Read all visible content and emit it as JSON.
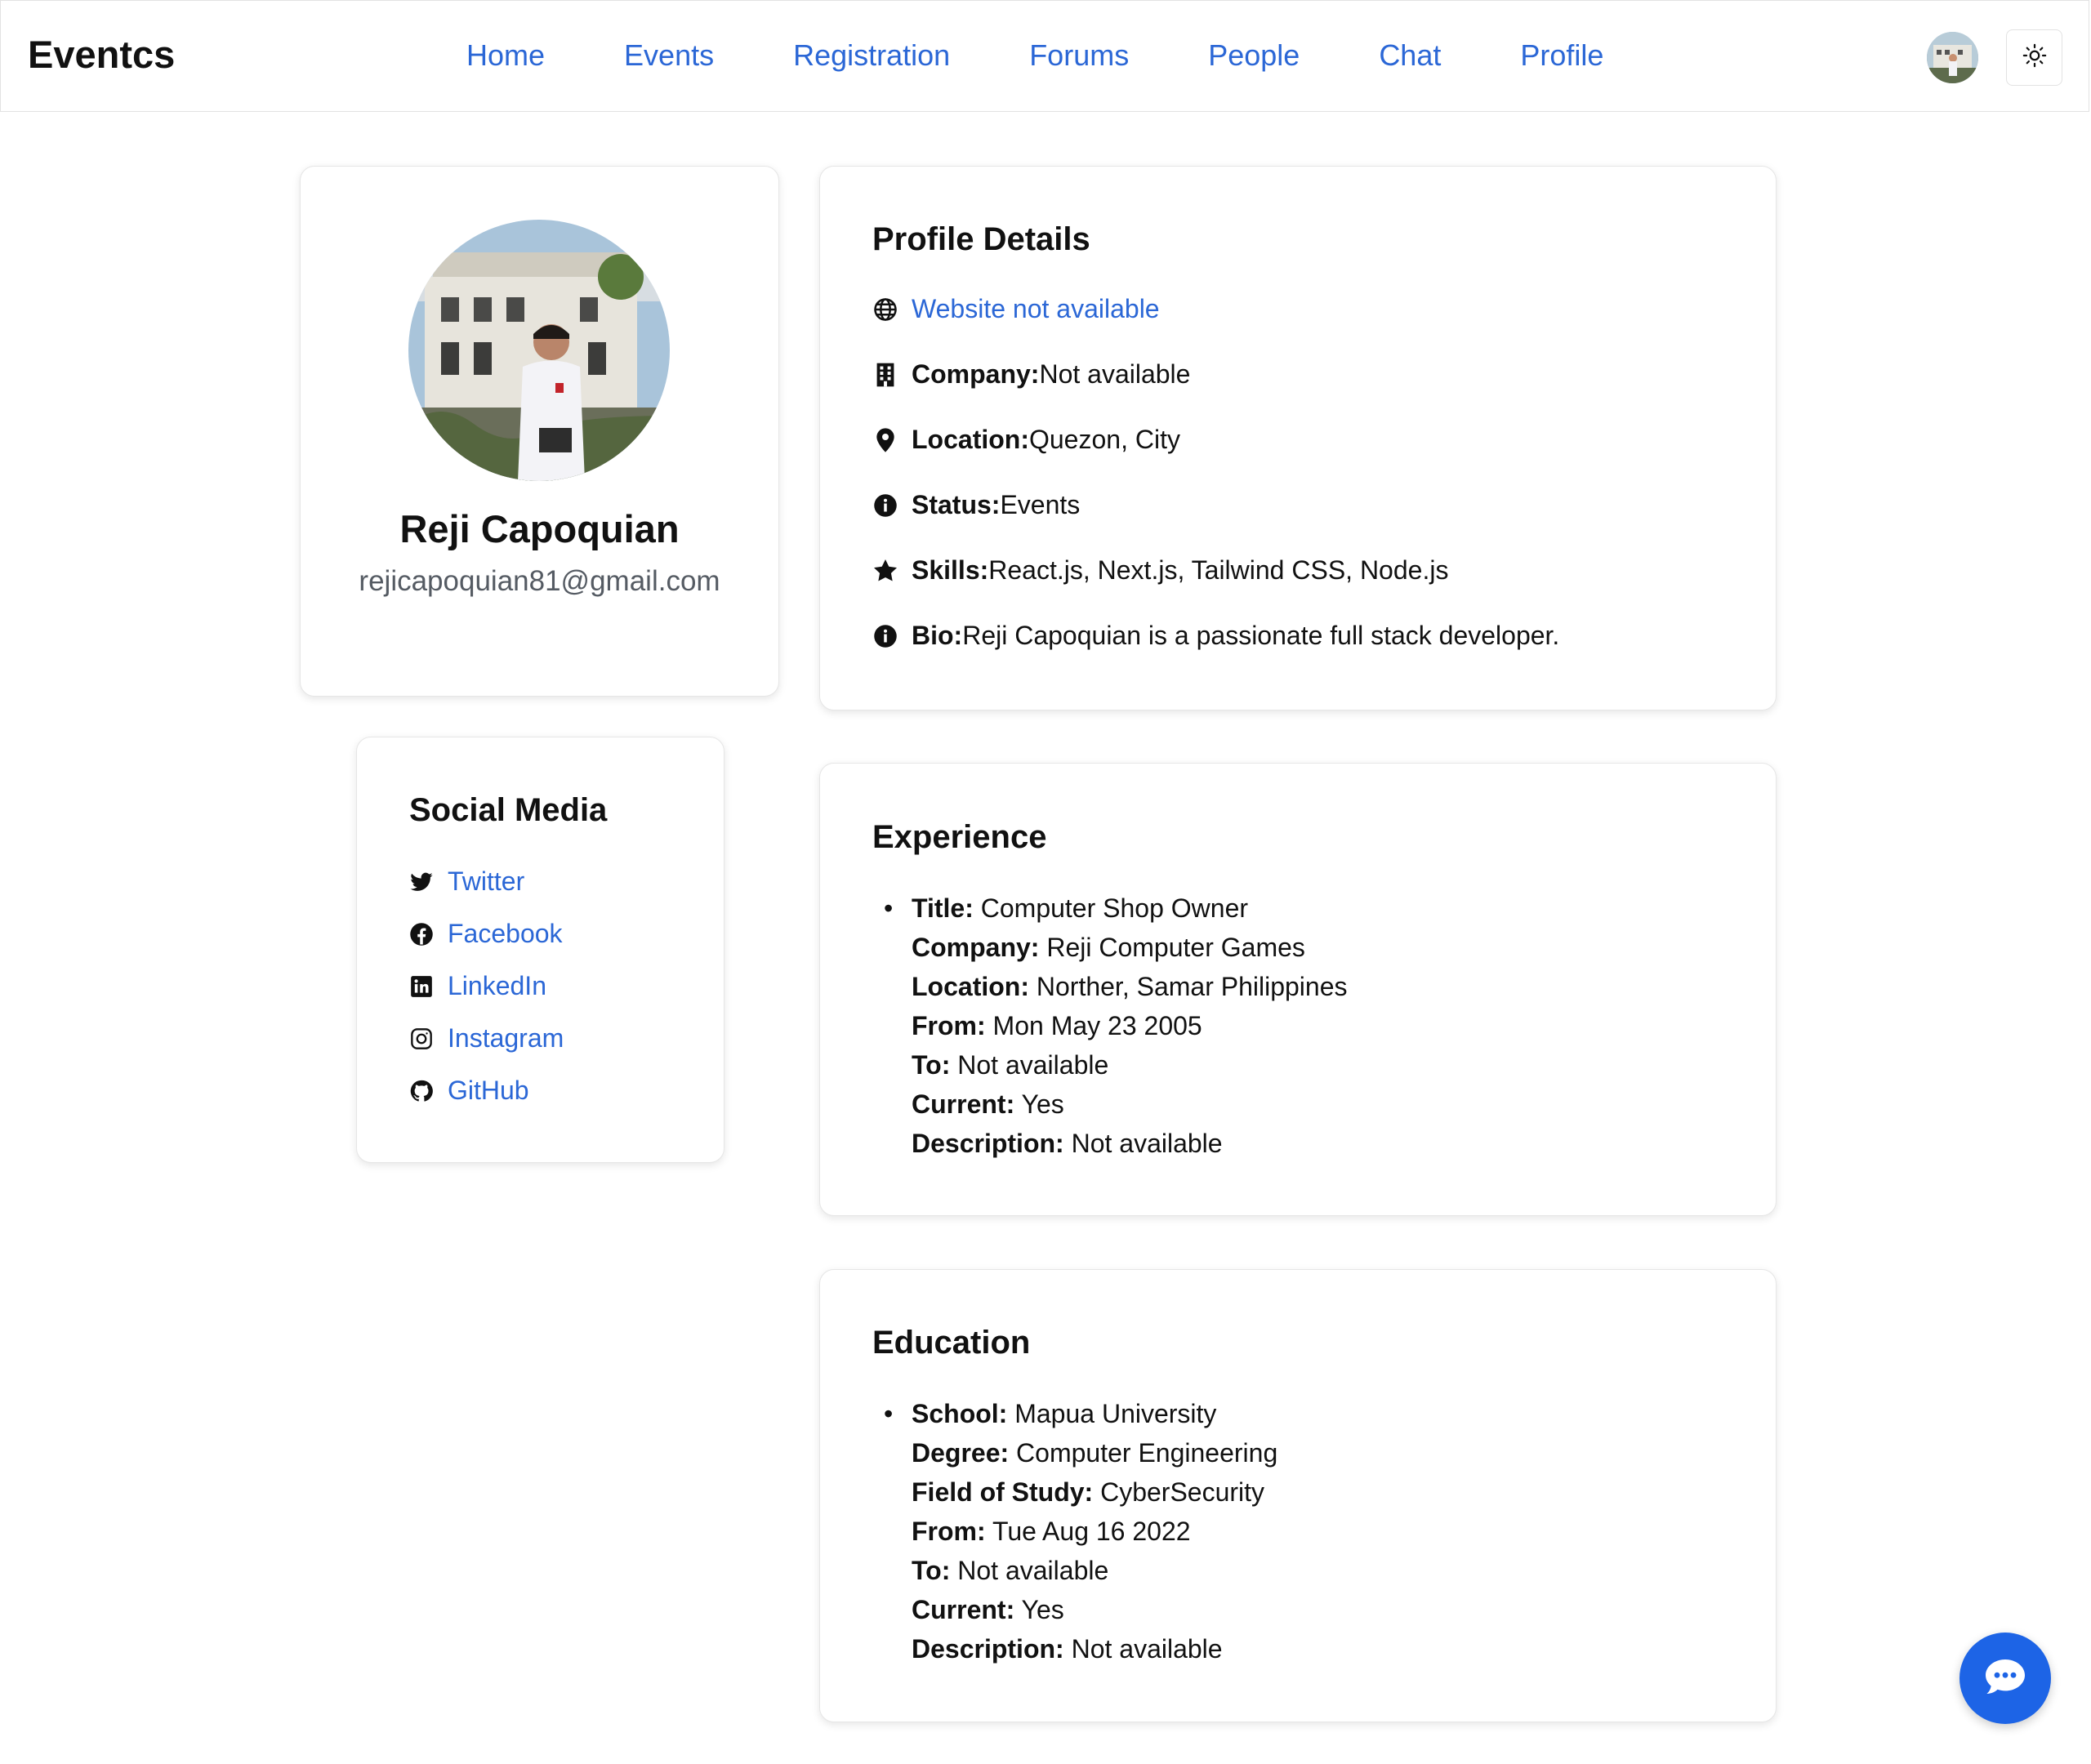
{
  "nav": {
    "brand": "Eventcs",
    "links": [
      "Home",
      "Events",
      "Registration",
      "Forums",
      "People",
      "Chat",
      "Profile"
    ]
  },
  "profile": {
    "name": "Reji Capoquian",
    "email": "rejicapoquian81@gmail.com"
  },
  "social": {
    "title": "Social Media",
    "links": [
      "Twitter",
      "Facebook",
      "LinkedIn",
      "Instagram",
      "GitHub"
    ]
  },
  "details": {
    "title": "Profile Details",
    "website": "Website not available",
    "company_label": "Company:",
    "company": "Not available",
    "location_label": "Location:",
    "location": "Quezon, City",
    "status_label": "Status:",
    "status": "Events",
    "skills_label": "Skills:",
    "skills": "React.js, Next.js, Tailwind CSS, Node.js",
    "bio_label": "Bio:",
    "bio": "Reji Capoquian is a passionate full stack developer."
  },
  "experience": {
    "title": "Experience",
    "items": [
      {
        "label": "Title:",
        "value": " Computer Shop Owner"
      },
      {
        "label": "Company:",
        "value": " Reji Computer Games"
      },
      {
        "label": "Location:",
        "value": " Norther, Samar Philippines"
      },
      {
        "label": "From:",
        "value": " Mon May 23 2005"
      },
      {
        "label": "To:",
        "value": " Not available"
      },
      {
        "label": "Current:",
        "value": " Yes"
      },
      {
        "label": "Description:",
        "value": " Not available"
      }
    ]
  },
  "education": {
    "title": "Education",
    "items": [
      {
        "label": "School:",
        "value": " Mapua University"
      },
      {
        "label": "Degree:",
        "value": " Computer Engineering"
      },
      {
        "label": "Field of Study:",
        "value": " CyberSecurity"
      },
      {
        "label": "From:",
        "value": " Tue Aug 16 2022"
      },
      {
        "label": "To:",
        "value": " Not available"
      },
      {
        "label": "Current:",
        "value": " Yes"
      },
      {
        "label": "Description:",
        "value": " Not available"
      }
    ]
  },
  "icons": {
    "theme": "sun-icon",
    "chat_fab": "chat-bubble-icon"
  },
  "colors": {
    "accent": "#2b67d6",
    "fab": "#1d64e6"
  }
}
